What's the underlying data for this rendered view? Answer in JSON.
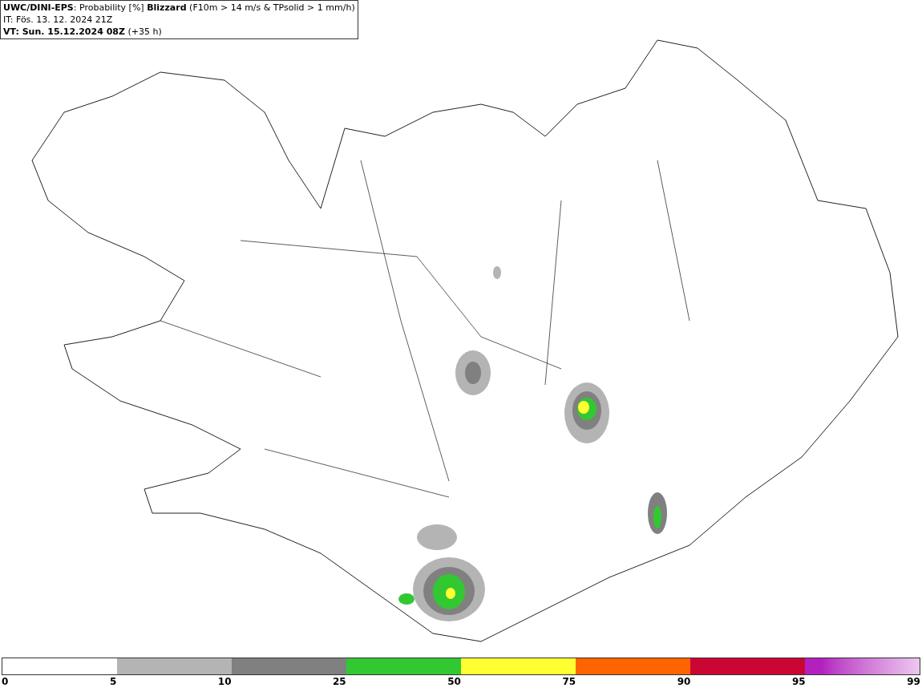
{
  "header": {
    "lines": [
      "**UWC/DINI-EPS**: Probability [%] **Blizzard** (F10m > 14 m/s & TPsolid > 1 mm/h)",
      "IT: Fös. 13. 12. 2024 21Z",
      "**VT: Sun. 15.12.2024 08Z** (+35 h)"
    ]
  },
  "legend": {
    "segments": [
      {
        "kind": "blank"
      },
      {
        "kind": "solid",
        "color": "#b4b4b4"
      },
      {
        "kind": "solid",
        "color": "#808080"
      },
      {
        "kind": "solid",
        "color": "#32c832"
      },
      {
        "kind": "solid",
        "color": "#ffff32"
      },
      {
        "kind": "solid",
        "color": "#ff6400"
      },
      {
        "kind": "solid",
        "color": "#cc0633"
      },
      {
        "kind": "gradient",
        "color": "#b420c0"
      }
    ],
    "labels": [
      "0",
      "5",
      "10",
      "25",
      "50",
      "75",
      "90",
      "95",
      "99"
    ]
  }
}
